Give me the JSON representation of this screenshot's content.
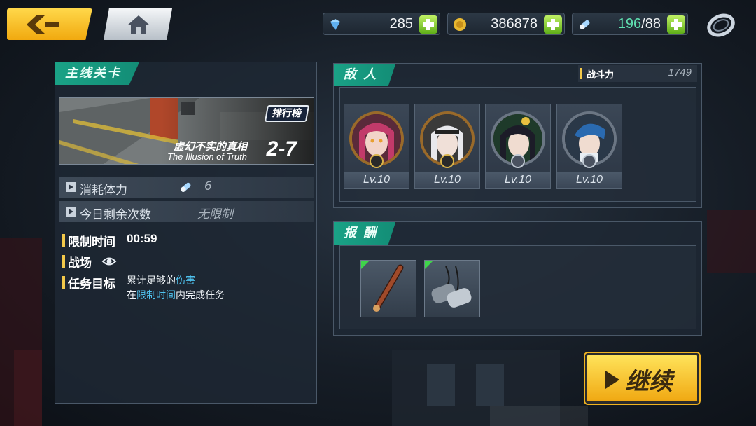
{
  "topbar": {
    "diamonds": "285",
    "gold": "386878",
    "stamina_current": "196",
    "stamina_max": "/88"
  },
  "stage": {
    "section_title": "主线关卡",
    "rank_label": "排行榜",
    "name_cn": "虚幻不实的真相",
    "name_en": "The Illusion of Truth",
    "number": "2-7",
    "cost_label": "消耗体力",
    "cost_value": "6",
    "remaining_label": "今日剩余次数",
    "remaining_value": "无限制",
    "time_limit_label": "限制时间",
    "time_limit_value": "00:59",
    "battlefield_label": "战场",
    "objective_label": "任务目标",
    "objective_line1_prefix": "累计足够的",
    "objective_line1_highlight": "伤害",
    "objective_line2_prefix": "在",
    "objective_line2_highlight": "限制时间",
    "objective_line2_suffix": "内完成任务"
  },
  "enemies": {
    "title": "敌 人",
    "power_label": "战斗力",
    "power_value": "1749",
    "list": [
      {
        "level": "Lv.10",
        "badge": "gold"
      },
      {
        "level": "Lv.10",
        "badge": "gold"
      },
      {
        "level": "Lv.10",
        "badge": "silver"
      },
      {
        "level": "Lv.10",
        "badge": "silver"
      }
    ]
  },
  "rewards": {
    "title": "报 酬",
    "items": [
      "baton-icon",
      "dog-tags-icon"
    ]
  },
  "continue_label": "继续",
  "colors": {
    "accent_gold": "#f2c84a",
    "accent_teal": "#1aa286",
    "highlight_blue": "#4fc3f0",
    "plus_green": "#5fae18"
  }
}
